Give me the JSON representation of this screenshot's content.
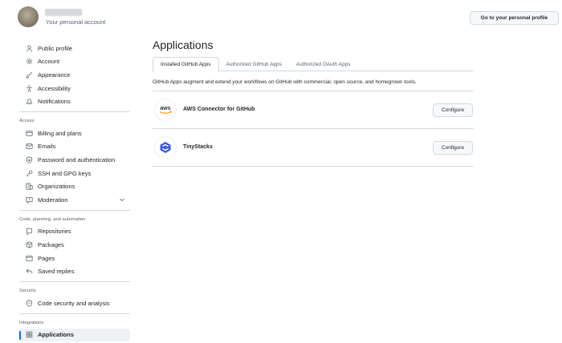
{
  "header": {
    "account_subtitle": "Your personal account",
    "profile_button": "Go to your personal profile"
  },
  "sidebar": {
    "items_top": [
      {
        "label": "Public profile",
        "icon": "person-icon"
      },
      {
        "label": "Account",
        "icon": "gear-icon"
      },
      {
        "label": "Appearance",
        "icon": "paintbrush-icon"
      },
      {
        "label": "Accessibility",
        "icon": "accessibility-icon"
      },
      {
        "label": "Notifications",
        "icon": "bell-icon"
      }
    ],
    "sections": [
      {
        "title": "Access",
        "items": [
          {
            "label": "Billing and plans",
            "icon": "credit-card-icon"
          },
          {
            "label": "Emails",
            "icon": "mail-icon"
          },
          {
            "label": "Password and authentication",
            "icon": "shield-lock-icon"
          },
          {
            "label": "SSH and GPG keys",
            "icon": "key-icon"
          },
          {
            "label": "Organizations",
            "icon": "organization-icon"
          },
          {
            "label": "Moderation",
            "icon": "report-icon"
          }
        ]
      },
      {
        "title": "Code, planning, and automation",
        "items": [
          {
            "label": "Repositories",
            "icon": "repo-icon"
          },
          {
            "label": "Packages",
            "icon": "package-icon"
          },
          {
            "label": "Pages",
            "icon": "browser-icon"
          },
          {
            "label": "Saved replies",
            "icon": "reply-icon"
          }
        ]
      },
      {
        "title": "Security",
        "items": [
          {
            "label": "Code security and analysis",
            "icon": "codescan-icon"
          }
        ]
      },
      {
        "title": "Integrations",
        "items": [
          {
            "label": "Applications",
            "icon": "apps-icon"
          }
        ]
      }
    ]
  },
  "main": {
    "title": "Applications",
    "tabs": [
      {
        "label": "Installed GitHub Apps"
      },
      {
        "label": "Authorized GitHub Apps"
      },
      {
        "label": "Authorized OAuth Apps"
      }
    ],
    "active_tab": "Installed GitHub Apps",
    "description": "GitHub Apps augment and extend your workflows on GitHub with commercial, open source, and homegrown tools.",
    "apps": [
      {
        "name": "AWS Connector for GitHub",
        "logo_text": "aws",
        "button": "Configure"
      },
      {
        "name": "TinyStacks",
        "logo_color": "#3d5ce0",
        "button": "Configure"
      }
    ]
  },
  "colors": {
    "accent": "#0969da",
    "border": "#d1d9e0",
    "muted_text": "#59636e",
    "aws_orange": "#ff9900"
  }
}
